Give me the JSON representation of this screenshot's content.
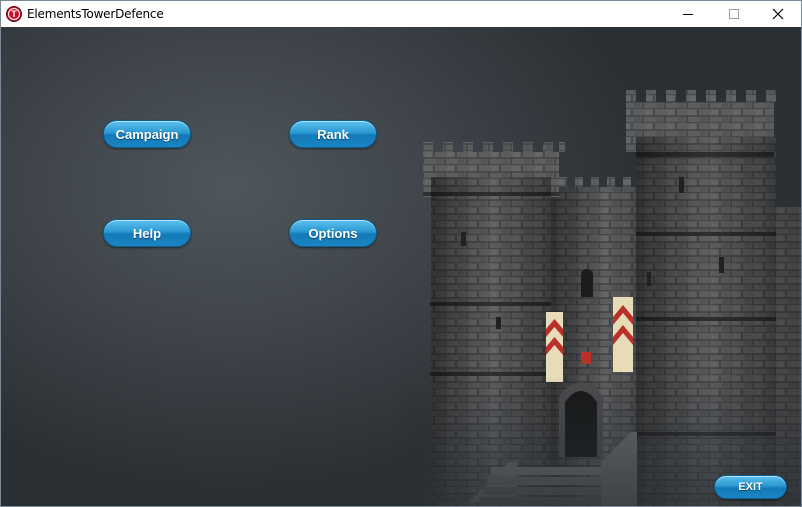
{
  "window": {
    "title": "ElementsTowerDefence",
    "app_icon_glyph": "T",
    "controls": [
      "minimize-icon",
      "maximize-icon",
      "close-icon"
    ]
  },
  "menu": {
    "campaign_label": "Campaign",
    "rank_label": "Rank",
    "help_label": "Help",
    "options_label": "Options",
    "exit_label": "EXIT"
  },
  "colors": {
    "button_blue": "#1a86c4",
    "background_gray": "#40464c",
    "banner_red": "#b8322a",
    "banner_cream": "#e8dcb8"
  }
}
